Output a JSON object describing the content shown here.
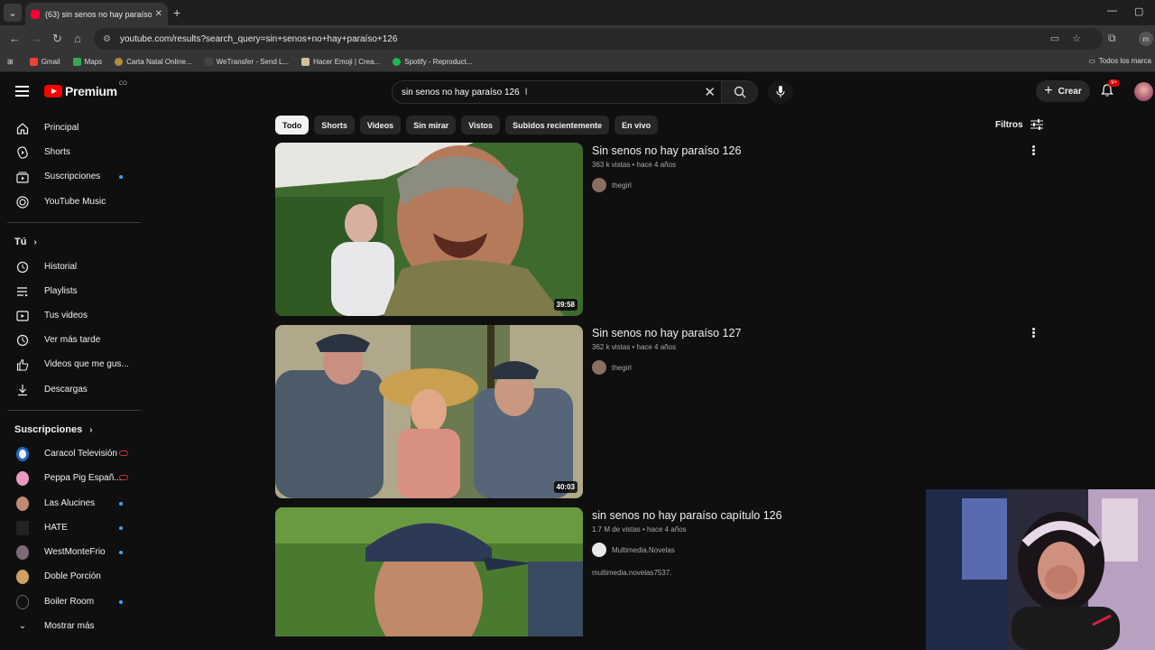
{
  "browser": {
    "tab_title": "(63) sin senos no hay paraíso 1",
    "url": "youtube.com/results?search_query=sin+senos+no+hay+paraíso+126",
    "bookmarks": [
      "Gmail",
      "Maps",
      "Carta Natal Online...",
      "WeTransfer - Send L...",
      "Hacer Emoji | Crea...",
      "Spotify - Reproduct..."
    ],
    "bookmarks_right": "Todos los marca",
    "profile_initial": "m"
  },
  "header": {
    "logo_text": "Premium",
    "logo_country": "CO",
    "search_value": "sin senos no hay paraíso 126",
    "create_label": "Crear",
    "notif_badge": "9+"
  },
  "sidebar": {
    "main": [
      {
        "label": "Principal",
        "icon": "home-icon"
      },
      {
        "label": "Shorts",
        "icon": "shorts-icon"
      },
      {
        "label": "Suscripciones",
        "icon": "subscriptions-icon"
      },
      {
        "label": "YouTube Music",
        "icon": "music-icon"
      }
    ],
    "you_label": "Tú",
    "you": [
      {
        "label": "Historial",
        "icon": "history-icon"
      },
      {
        "label": "Playlists",
        "icon": "playlists-icon"
      },
      {
        "label": "Tus videos",
        "icon": "your-videos-icon"
      },
      {
        "label": "Ver más tarde",
        "icon": "watch-later-icon"
      },
      {
        "label": "Videos que me gus...",
        "icon": "liked-icon"
      },
      {
        "label": "Descargas",
        "icon": "download-icon"
      }
    ],
    "subs_label": "Suscripciones",
    "subs": [
      {
        "label": "Caracol Televisión"
      },
      {
        "label": "Peppa Pig Españ..."
      },
      {
        "label": "Las Alucines"
      },
      {
        "label": "HATE"
      },
      {
        "label": "WestMonteFrio"
      },
      {
        "label": "Doble Porción"
      },
      {
        "label": "Boiler Room"
      }
    ],
    "show_more": "Mostrar más"
  },
  "chips": [
    "Todo",
    "Shorts",
    "Videos",
    "Sin mirar",
    "Vistos",
    "Subidos recientemente",
    "En vivo"
  ],
  "filters_label": "Filtros",
  "results": [
    {
      "title": "Sin senos no hay paraíso 126",
      "meta": "363 k vistas • hace 4 años",
      "channel": "thegirl",
      "duration": "39:58",
      "desc": ""
    },
    {
      "title": "Sin senos no hay paraíso 127",
      "meta": "362 k vistas • hace 4 años",
      "channel": "thegirl",
      "duration": "40:03",
      "desc": ""
    },
    {
      "title": "sin senos no hay paraíso capítulo 126",
      "meta": "1.7 M de vistas • hace 4 años",
      "channel": "Multimedia.Novelas",
      "duration": "",
      "desc": "multimedia.novelas7537."
    }
  ]
}
